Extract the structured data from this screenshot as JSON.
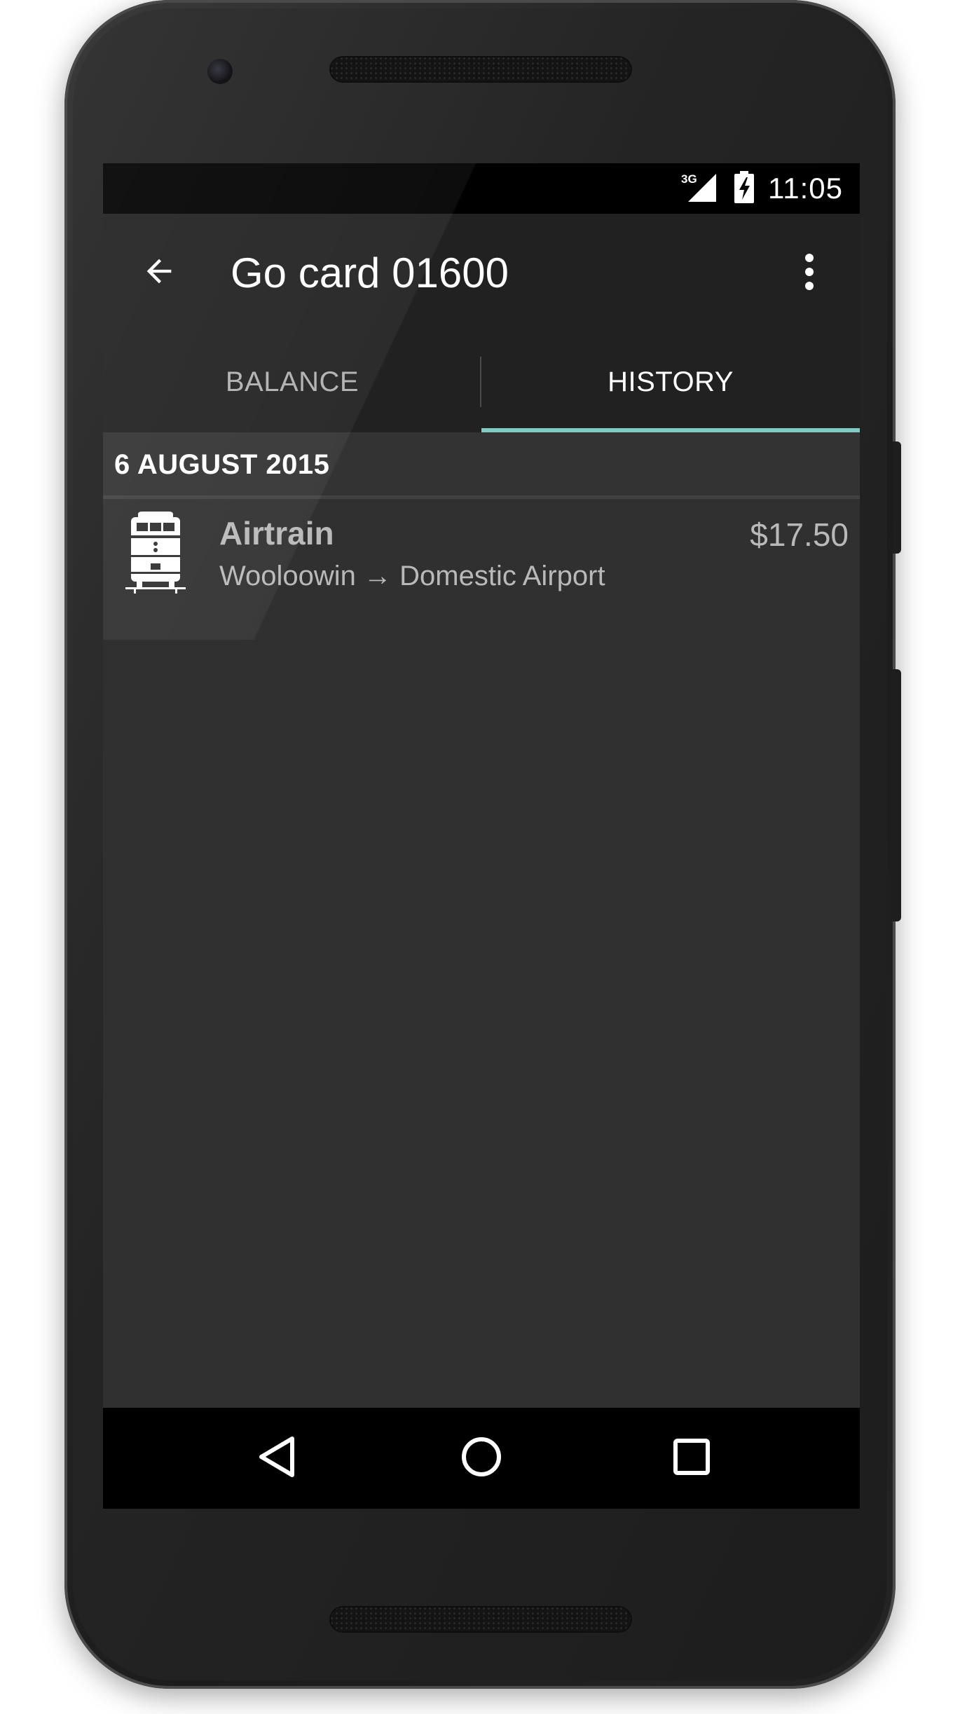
{
  "status_bar": {
    "network": "3G",
    "time": "11:05"
  },
  "app_bar": {
    "back_icon": "arrow-back-icon",
    "title": "Go card 01600",
    "overflow_icon": "more-vert-icon"
  },
  "tabs": [
    {
      "label": "BALANCE",
      "active": false
    },
    {
      "label": "HISTORY",
      "active": true
    }
  ],
  "history": {
    "date_header": "6 AUGUST 2015",
    "trips": [
      {
        "icon": "train-icon",
        "name": "Airtrain",
        "route": "Wooloowin → Domestic Airport",
        "fare": "$17.50"
      }
    ]
  },
  "nav_bar": {
    "back_icon": "nav-back-icon",
    "home_icon": "nav-home-icon",
    "recents_icon": "nav-recents-icon"
  },
  "colors": {
    "accent": "#80cbc4",
    "app_bar": "#212121",
    "background": "#303030"
  }
}
